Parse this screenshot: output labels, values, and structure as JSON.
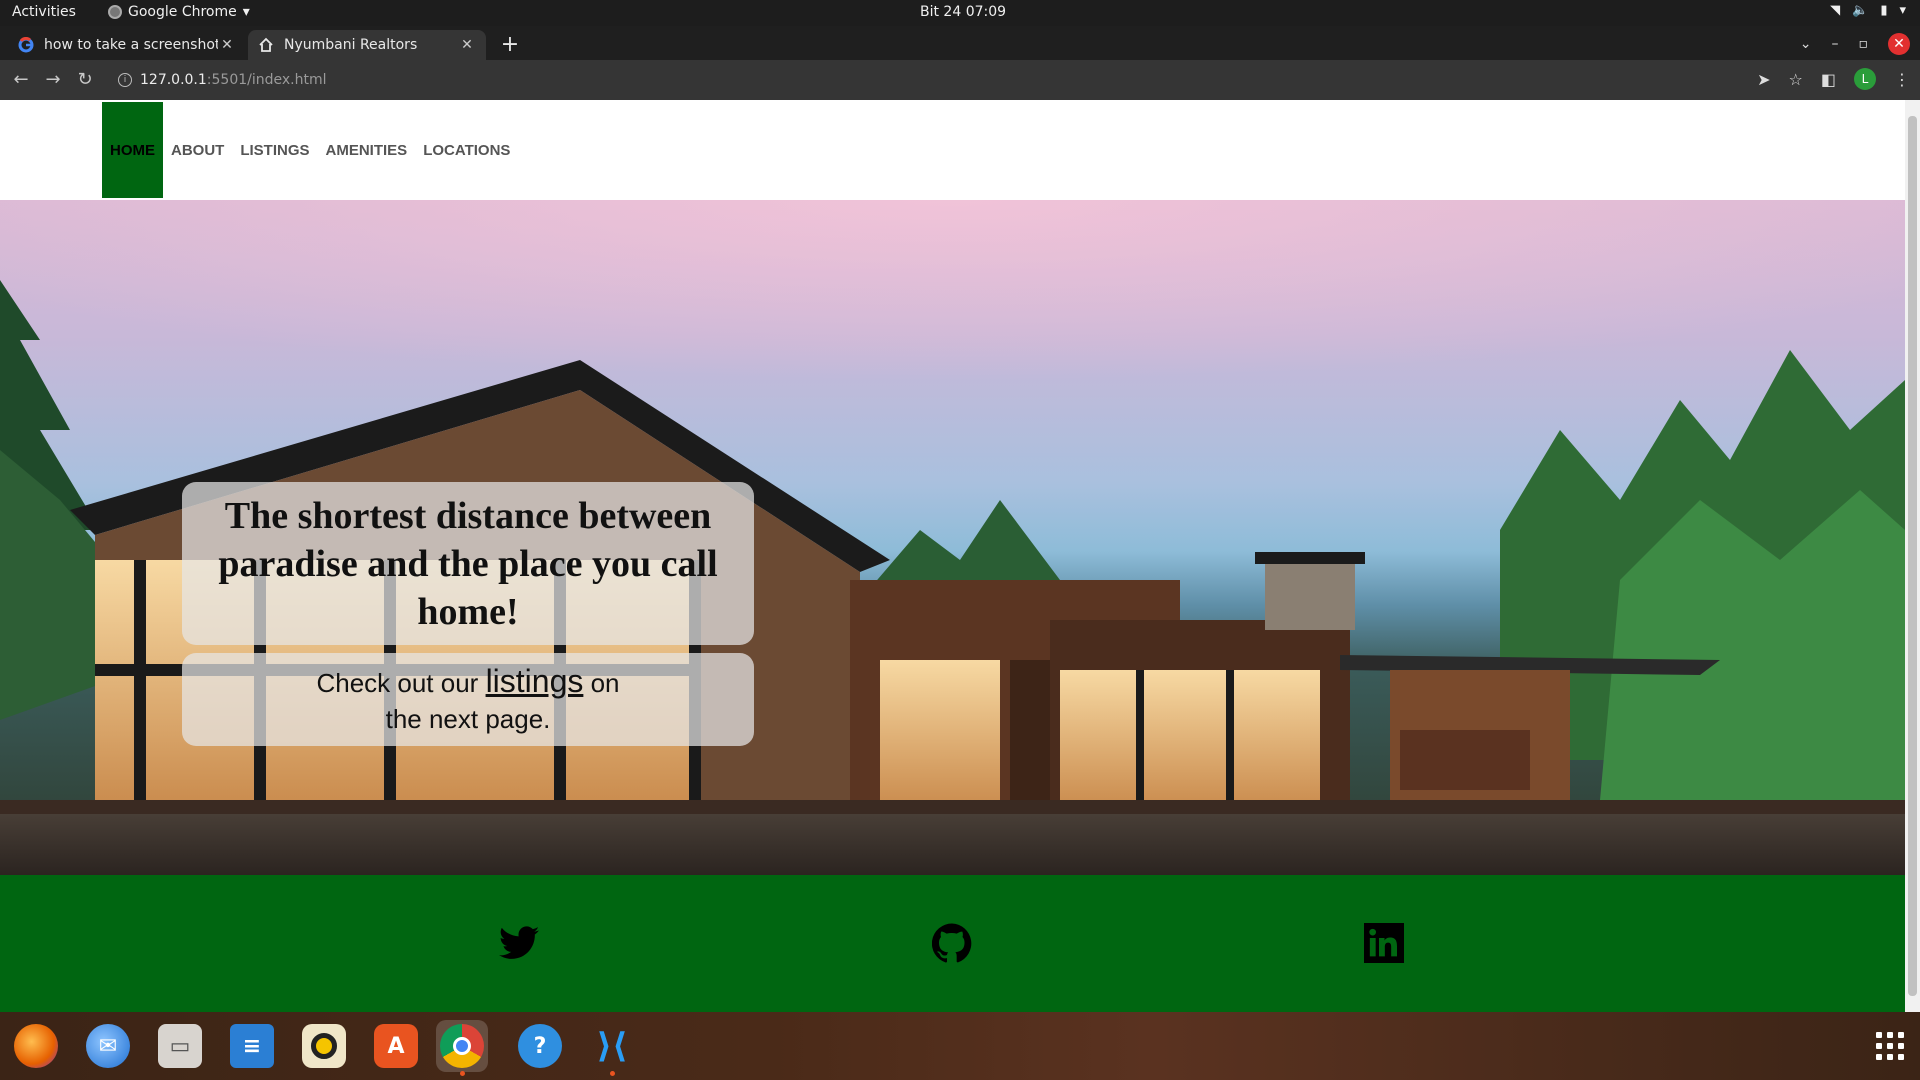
{
  "system_bar": {
    "activities": "Activities",
    "app_name": "Google Chrome",
    "clock": "Bit 24  07:09"
  },
  "browser": {
    "tabs": [
      {
        "title": "how to take a screenshot",
        "favicon": "google-icon"
      },
      {
        "title": "Nyumbani Realtors",
        "favicon": "home-icon"
      }
    ],
    "url_host": "127.0.0.1",
    "url_rest": ":5501/index.html",
    "profile_initial": "L"
  },
  "site": {
    "nav": [
      {
        "label": "HOME",
        "active": true
      },
      {
        "label": "ABOUT"
      },
      {
        "label": "LISTINGS"
      },
      {
        "label": "AMENITIES"
      },
      {
        "label": "LOCATIONS"
      }
    ],
    "headline": "The shortest distance between paradise and the place you call home!",
    "sub_before": "Check out our ",
    "sub_link": "listings",
    "sub_after": " on the next page.",
    "social": [
      "twitter-icon",
      "github-icon",
      "linkedin-icon"
    ],
    "colors": {
      "accent_green": "#006611"
    }
  },
  "dock": {
    "apps": [
      "firefox",
      "thunderbird",
      "files",
      "libreoffice-writer",
      "rhythmbox",
      "ubuntu-software",
      "google-chrome",
      "help",
      "vscode"
    ]
  }
}
